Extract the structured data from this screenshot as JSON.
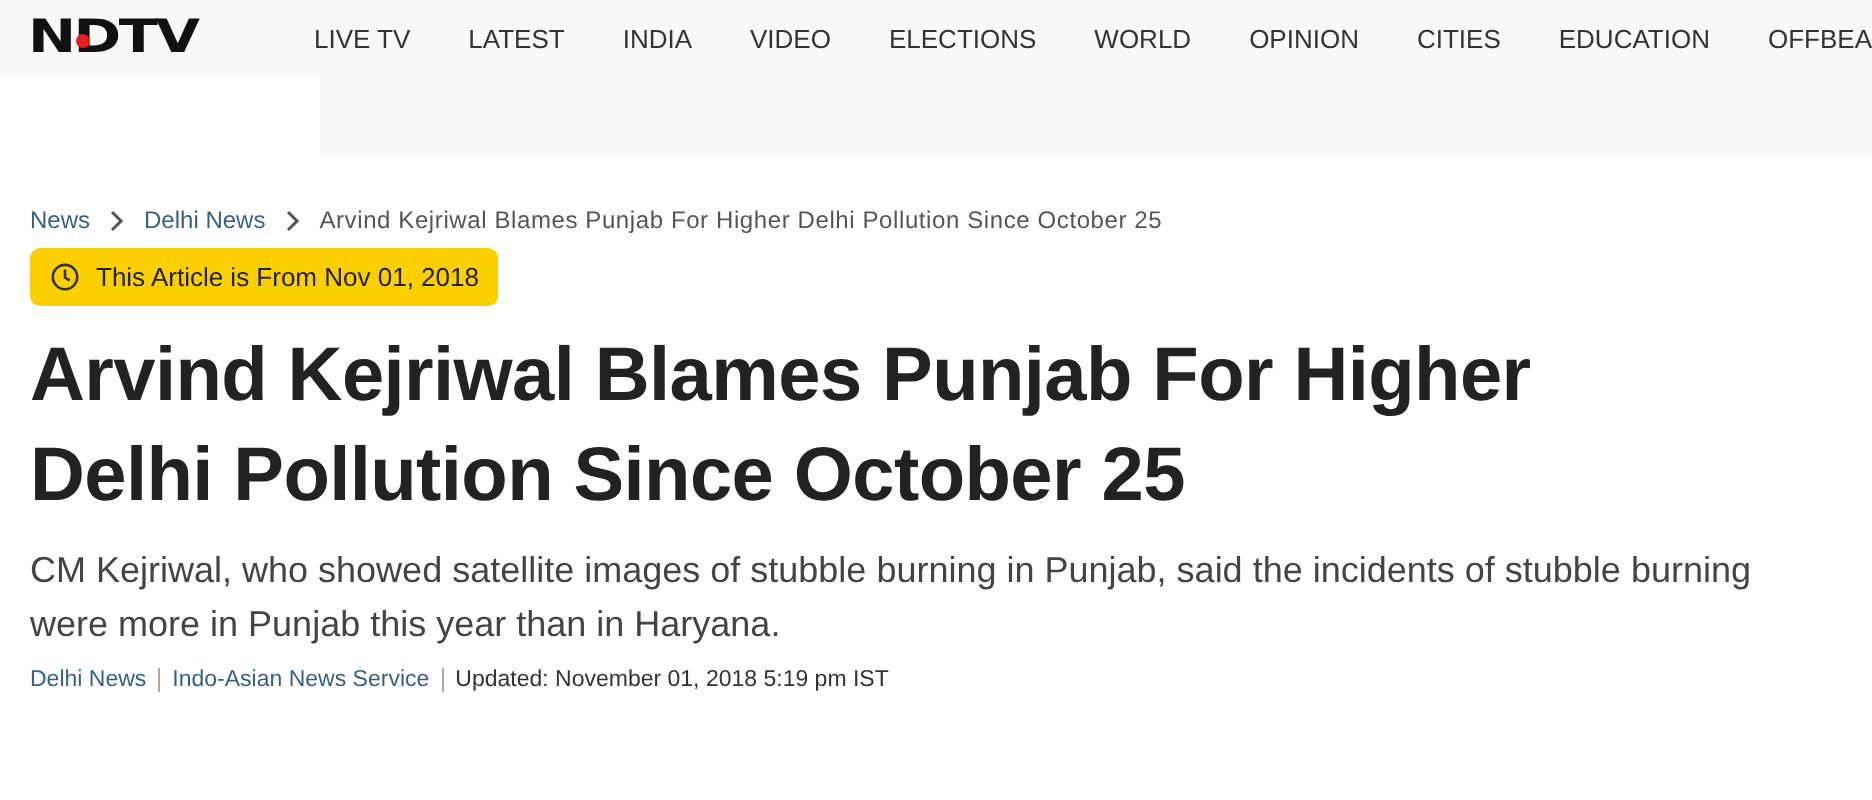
{
  "header": {
    "logo": "NDTV",
    "nav": [
      "LIVE TV",
      "LATEST",
      "INDIA",
      "VIDEO",
      "ELECTIONS",
      "WORLD",
      "OPINION",
      "CITIES",
      "EDUCATION",
      "OFFBEA"
    ]
  },
  "breadcrumbs": [
    {
      "label": "News",
      "kind": "link"
    },
    {
      "label": "Delhi News",
      "kind": "link"
    },
    {
      "label": "Arvind Kejriwal Blames Punjab For Higher Delhi Pollution Since October 25",
      "kind": "current"
    }
  ],
  "date_badge": "This Article is From Nov 01, 2018",
  "headline": "Arvind Kejriwal Blames Punjab For Higher Delhi Pollution Since October 25",
  "summary": "CM Kejriwal, who showed satellite images of stubble burning in Punjab, said the incidents of stubble burning were more in Punjab this year than in Haryana.",
  "byline": {
    "category": "Delhi News",
    "source": "Indo-Asian News Service",
    "updated": "Updated: November 01, 2018 5:19 pm IST"
  }
}
